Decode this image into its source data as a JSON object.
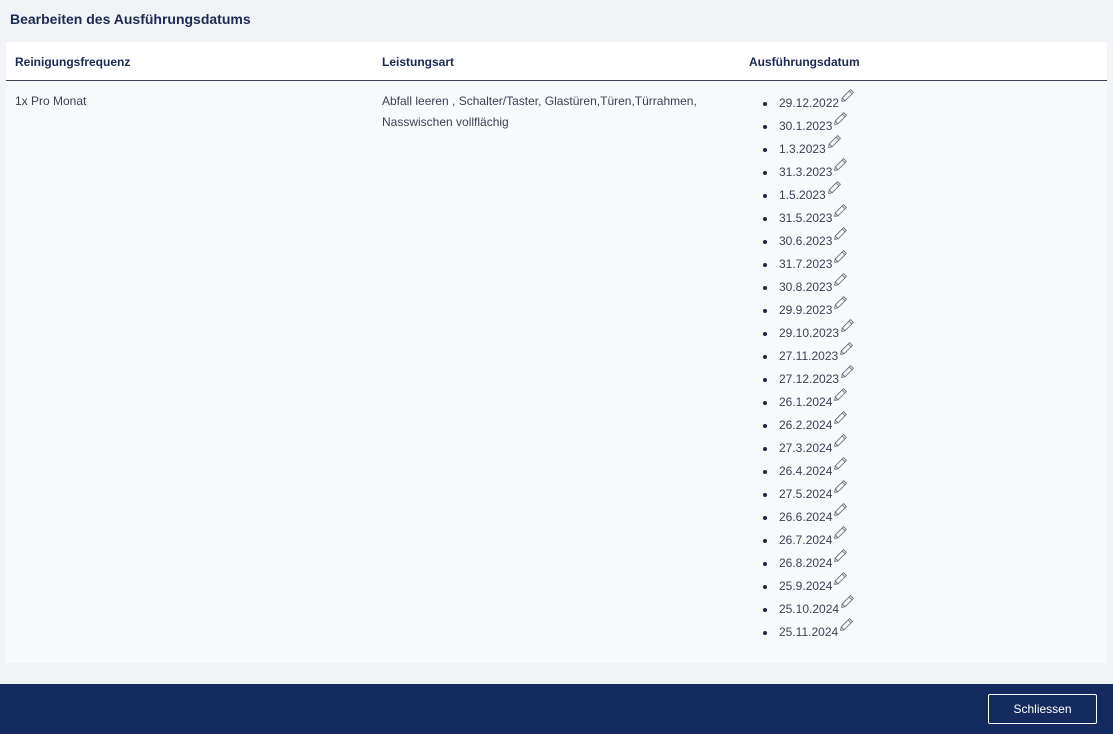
{
  "dialog": {
    "title": "Bearbeiten des Ausführungsdatums"
  },
  "table": {
    "headers": {
      "frequency": "Reinigungsfrequenz",
      "service_type": "Leistungsart",
      "execution_date": "Ausführungsdatum"
    },
    "row": {
      "frequency": "1x Pro Monat",
      "service_type": "Abfall leeren , Schalter/Taster, Glastüren,Türen,Türrahmen, Nasswischen vollflächig",
      "dates": [
        "29.12.2022",
        "30.1.2023",
        "1.3.2023",
        "31.3.2023",
        "1.5.2023",
        "31.5.2023",
        "30.6.2023",
        "31.7.2023",
        "30.8.2023",
        "29.9.2023",
        "29.10.2023",
        "27.11.2023",
        "27.12.2023",
        "26.1.2024",
        "26.2.2024",
        "27.3.2024",
        "26.4.2024",
        "27.5.2024",
        "26.6.2024",
        "26.7.2024",
        "26.8.2024",
        "25.9.2024",
        "25.10.2024",
        "25.11.2024"
      ]
    }
  },
  "icons": {
    "edit": "pencil-icon"
  },
  "footer": {
    "close_label": "Schliessen"
  },
  "colors": {
    "footer_bg": "#152a5e",
    "title": "#1b2a52",
    "text": "#3a4256"
  }
}
